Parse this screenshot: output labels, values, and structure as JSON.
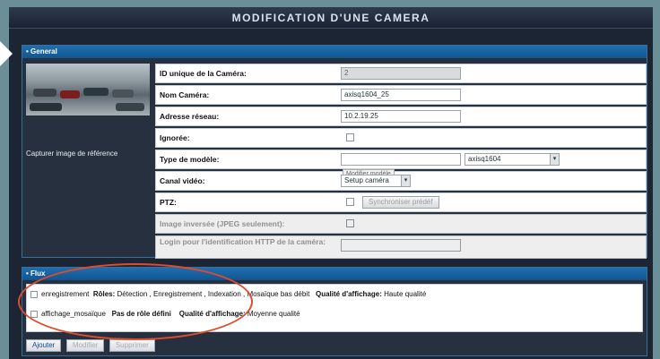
{
  "title": "MODIFICATION D'UNE CAMERA",
  "general": {
    "header": "• General",
    "capture_label": "Capturer image de référence",
    "fields": {
      "id_label": "ID unique de la Caméra:",
      "id_value": "2",
      "name_label": "Nom Caméra:",
      "name_value": "axisq1604_25",
      "address_label": "Adresse réseau:",
      "address_value": "10.2.19.25",
      "ignored_label": "Ignorée:",
      "model_label": "Type de modèle:",
      "model_input": "",
      "model_select": "axisq1604",
      "model_tooltip": "Modifier modèle",
      "channel_label": "Canal vidéo:",
      "channel_select": "Setup caméra",
      "ptz_label": "PTZ:",
      "ptz_button": "Synchroniser prédéf",
      "invert_label": "Image inversée (JPEG seulement):",
      "login_label": "Login pour l'identification HTTP de la caméra:"
    }
  },
  "flux": {
    "header": "• Flux",
    "items": [
      {
        "name": "enregistrement",
        "roles_label": "Rôles:",
        "roles_value": "Détection , Enregistrement , Indexation , Mosaïque bas débit",
        "quality_label": "Qualité d'affichage:",
        "quality_value": "Haute qualité"
      },
      {
        "name": "affichage_mosaïque",
        "roles_label": "Pas de rôle défini",
        "roles_value": "",
        "quality_label": "Qualité d'affichage:",
        "quality_value": "Moyenne qualité"
      }
    ],
    "buttons": {
      "add": "Ajouter",
      "modify": "Modifier",
      "delete": "Supprimer"
    }
  },
  "colors": {
    "accent": "#1f6fb0",
    "annotation": "#e24a2c"
  }
}
